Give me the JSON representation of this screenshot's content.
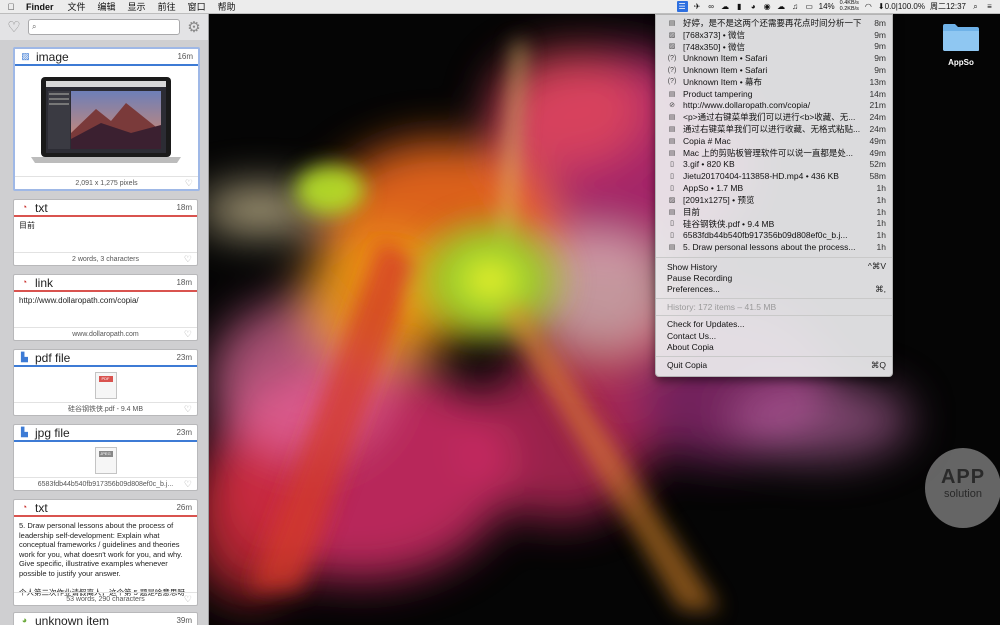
{
  "menubar": {
    "app_name": "Finder",
    "menus": [
      "文件",
      "编辑",
      "显示",
      "前往",
      "窗口",
      "帮助"
    ],
    "battery": "14%",
    "net_up": "0.4KB/s",
    "net_down": "0.2KB/s",
    "bt": "⬇0.0|100.0%",
    "clock": "周二12:37"
  },
  "sidebar": {
    "search_placeholder": "",
    "cards": [
      {
        "type": "image",
        "age": "16m",
        "footer": "2,091 x 1,275 pixels"
      },
      {
        "type": "txt",
        "age": "18m",
        "content": "目前",
        "footer": "2 words, 3 characters"
      },
      {
        "type": "link",
        "age": "18m",
        "content": "http://www.dollaropath.com/copia/",
        "footer": "www.dollaropath.com"
      },
      {
        "type": "pdf file",
        "age": "23m",
        "badge": "PDF",
        "footer": "硅谷钢铁侠.pdf - 9.4 MB"
      },
      {
        "type": "jpg file",
        "age": "23m",
        "badge": "JPEG",
        "footer": "6583fdb44b540fb917356b09d808ef0c_b.j..."
      },
      {
        "type": "txt",
        "age": "26m",
        "content": "5. Draw personal lessons about the process of leadership self-development: Explain what conceptual frameworks / guidelines and theories work for you, what doesn't work for you, and why. Give specific, illustrative examples whenever possible to justify your answer.",
        "content2": "个人第二次作业请假离人，这个第 5 题是啥意思呀",
        "footer": "53 words, 290 characters"
      },
      {
        "type": "unknown item",
        "age": "39m"
      }
    ]
  },
  "dropdown": {
    "items": [
      {
        "icon": "doc-icon",
        "glyph": "▤",
        "text": "好婷，是不是这两个还需要再花点时间分析一下",
        "age": "8m"
      },
      {
        "icon": "image-icon",
        "glyph": "▨",
        "text": "[768x373] • 微信",
        "age": "9m"
      },
      {
        "icon": "image-icon",
        "glyph": "▨",
        "text": "[748x350] • 微信",
        "age": "9m"
      },
      {
        "icon": "unknown-icon",
        "glyph": "(?)",
        "text": "Unknown Item • Safari",
        "age": "9m"
      },
      {
        "icon": "unknown-icon",
        "glyph": "(?)",
        "text": "Unknown Item • Safari",
        "age": "9m"
      },
      {
        "icon": "unknown-icon",
        "glyph": "(?)",
        "text": "Unknown Item • 幕布",
        "age": "13m"
      },
      {
        "icon": "doc-icon",
        "glyph": "▤",
        "text": "Product tampering",
        "age": "14m"
      },
      {
        "icon": "link-icon",
        "glyph": "⊘",
        "text": "http://www.dollaropath.com/copia/",
        "age": "21m"
      },
      {
        "icon": "doc-icon",
        "glyph": "▤",
        "text": "<p>通过右键菜单我们可以进行<b>收藏、无...",
        "age": "24m"
      },
      {
        "icon": "doc-icon",
        "glyph": "▤",
        "text": "通过右键菜单我们可以进行收藏、无格式粘贴...",
        "age": "24m"
      },
      {
        "icon": "doc-icon",
        "glyph": "▤",
        "text": "Copia # Mac",
        "age": "49m"
      },
      {
        "icon": "doc-icon",
        "glyph": "▤",
        "text": "Mac 上的剪贴板管理软件可以说一直都是处...",
        "age": "49m"
      },
      {
        "icon": "file-icon",
        "glyph": "▯",
        "text": "3.gif • 820 KB",
        "age": "52m"
      },
      {
        "icon": "file-icon",
        "glyph": "▯",
        "text": "Jietu20170404-113858-HD.mp4 • 436 KB",
        "age": "58m"
      },
      {
        "icon": "file-icon",
        "glyph": "▯",
        "text": "AppSo • 1.7 MB",
        "age": "1h"
      },
      {
        "icon": "image-icon",
        "glyph": "▨",
        "text": "[2091x1275] • 预览",
        "age": "1h"
      },
      {
        "icon": "doc-icon",
        "glyph": "▤",
        "text": "目前",
        "age": "1h"
      },
      {
        "icon": "file-icon",
        "glyph": "▯",
        "text": "硅谷钢铁侠.pdf • 9.4 MB",
        "age": "1h"
      },
      {
        "icon": "file-icon",
        "glyph": "▯",
        "text": "6583fdb44b540fb917356b09d808ef0c_b.j...",
        "age": "1h"
      },
      {
        "icon": "doc-icon",
        "glyph": "▤",
        "text": "5. Draw personal lessons about the process...",
        "age": "1h"
      }
    ],
    "commands_a": [
      {
        "label": "Show History",
        "shortcut": "^⌘V"
      },
      {
        "label": "Pause Recording",
        "shortcut": ""
      },
      {
        "label": "Preferences...",
        "shortcut": "⌘,"
      }
    ],
    "history_info": "History: 172 items – 41.5 MB",
    "commands_b": [
      {
        "label": "Check for Updates...",
        "shortcut": ""
      },
      {
        "label": "Contact Us...",
        "shortcut": ""
      },
      {
        "label": "About Copia",
        "shortcut": ""
      }
    ],
    "quit": {
      "label": "Quit Copia",
      "shortcut": "⌘Q"
    }
  },
  "desktop": {
    "folder_label": "AppSo"
  },
  "watermark": {
    "line1": "APP",
    "line2": "solution"
  }
}
